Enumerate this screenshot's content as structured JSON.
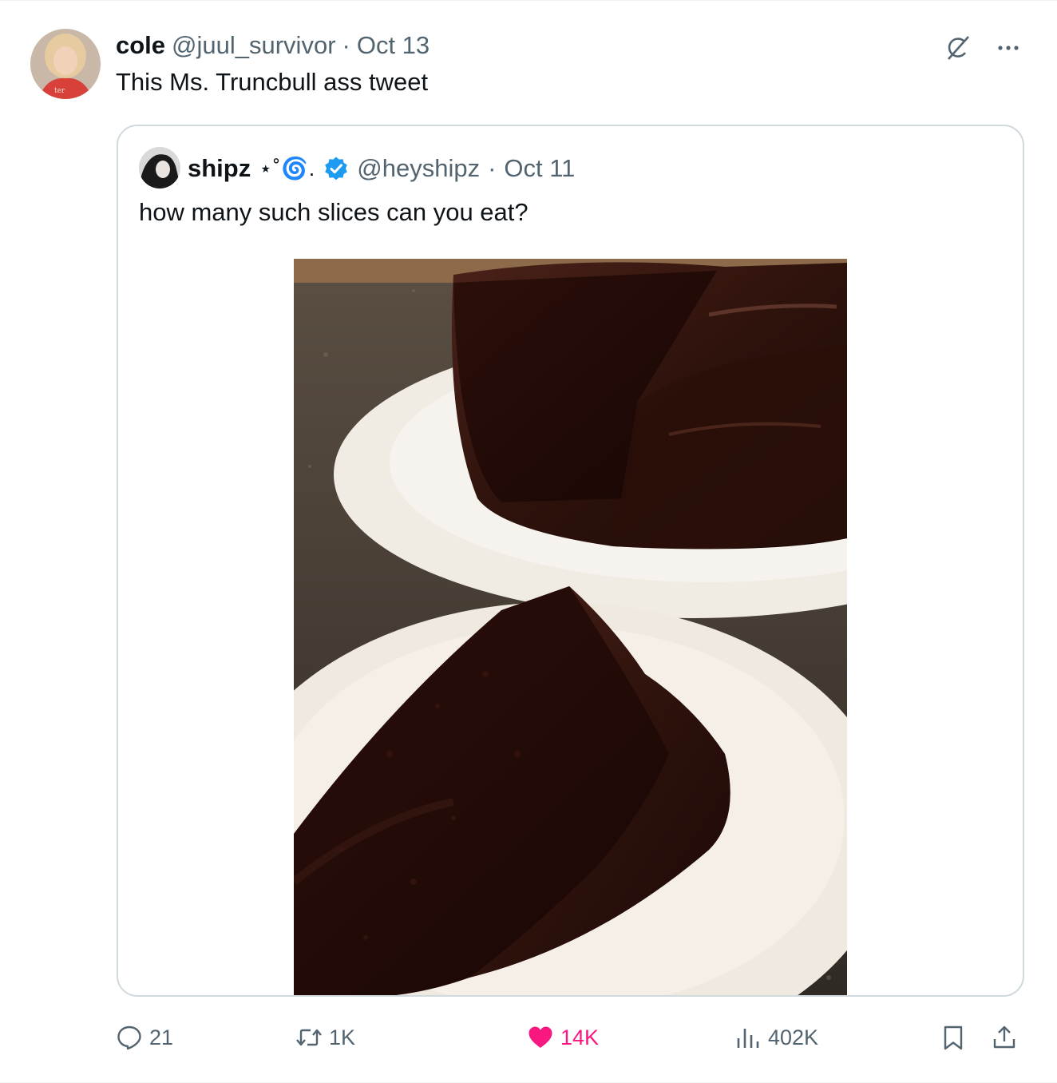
{
  "tweet": {
    "author_name": "cole",
    "author_handle": "@juul_survivor",
    "separator": "·",
    "date": "Oct 13",
    "text": "This Ms. Truncbull ass tweet"
  },
  "quoted": {
    "author_name": "shipz",
    "author_emoji": "⋆˚🌀.",
    "verified": true,
    "author_handle": "@heyshipz",
    "separator": "·",
    "date": "Oct 11",
    "text": "how many such slices can you eat?",
    "media_description": "chocolate-cake-photo"
  },
  "actions": {
    "replies": "21",
    "reposts": "1K",
    "likes": "14K",
    "views": "402K"
  },
  "icons": {
    "top_right": [
      "grok-icon",
      "more-icon"
    ],
    "bottom": [
      "reply-icon",
      "retweet-icon",
      "like-icon",
      "views-icon",
      "bookmark-icon",
      "share-icon"
    ]
  },
  "colors": {
    "text_primary": "#0f1419",
    "text_secondary": "#536471",
    "like_active": "#f91880",
    "verified_blue": "#1d9bf0",
    "border": "#cfd9de"
  }
}
